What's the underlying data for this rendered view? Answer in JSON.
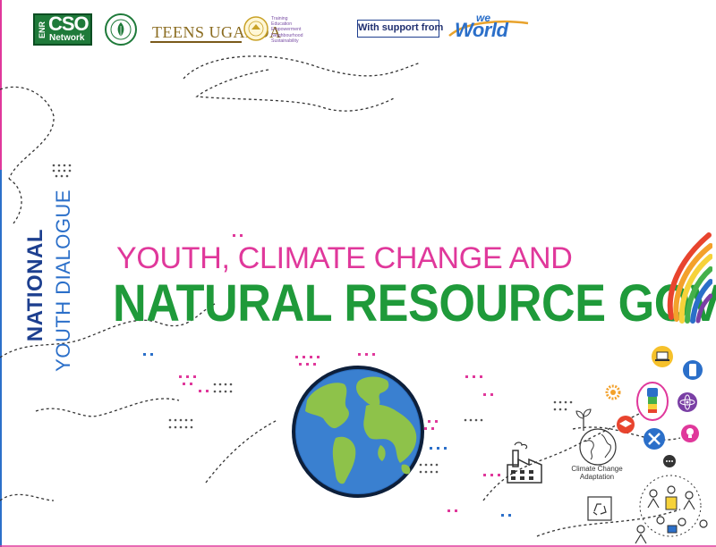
{
  "logos": {
    "enr_cso": {
      "side": "ENR",
      "main": "CSO",
      "sub": "Network"
    },
    "teens_uganda": {
      "name": "TEENS UGANDA",
      "tags": [
        "Training",
        "Education",
        "Empowerment",
        "Neighbourhood",
        "Sustainability"
      ]
    },
    "support_text": "With support from",
    "weworld": {
      "small": "we",
      "big": "World"
    }
  },
  "side_title": {
    "line1": "NATIONAL",
    "line2": "YOUTH DIALOGUE"
  },
  "headline": {
    "line1": "YOUTH, CLIMATE CHANGE AND",
    "line2": "NATURAL RESOURCE GOVERNANCE"
  },
  "illustration": {
    "caption": "Climate Change Adaptation"
  },
  "colors": {
    "pink": "#e0389b",
    "green": "#1f9a3a",
    "navy": "#1d3f8f",
    "blue": "#2b6fc9"
  },
  "icons": [
    "enr-cso-logo",
    "environment-seal-logo",
    "teens-uganda-seal",
    "weworld-logo",
    "rainbow-hands-icon",
    "globe-icon",
    "factory-icon",
    "recycle-bin-icon",
    "laptop-icon",
    "phone-icon",
    "gear-icon",
    "fist-icon",
    "atom-icon",
    "graduation-cap-icon",
    "tools-icon",
    "lightbulb-icon",
    "plant-icon",
    "chat-bubble-icon",
    "community-people-icon"
  ]
}
